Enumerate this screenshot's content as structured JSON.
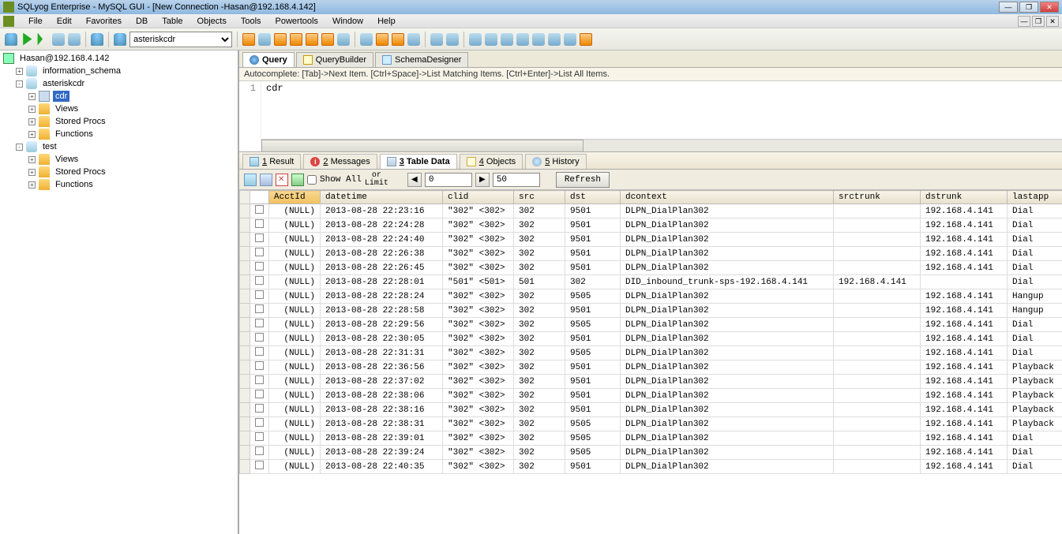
{
  "titlebar": {
    "title": "SQLyog Enterprise - MySQL GUI - [New Connection -Hasan@192.168.4.142]"
  },
  "menubar": {
    "items": [
      "File",
      "Edit",
      "Favorites",
      "DB",
      "Table",
      "Objects",
      "Tools",
      "Powertools",
      "Window",
      "Help"
    ]
  },
  "toolbar": {
    "db_select": "asteriskcdr"
  },
  "sidebar": {
    "root": "Hasan@192.168.4.142",
    "nodes": [
      {
        "level": 1,
        "exp": "+",
        "icon": "db",
        "label": "information_schema"
      },
      {
        "level": 1,
        "exp": "-",
        "icon": "db",
        "label": "asteriskcdr"
      },
      {
        "level": 2,
        "exp": "+",
        "icon": "table",
        "label": "cdr",
        "selected": true
      },
      {
        "level": 2,
        "exp": "+",
        "icon": "folder",
        "label": "Views"
      },
      {
        "level": 2,
        "exp": "+",
        "icon": "folder",
        "label": "Stored Procs"
      },
      {
        "level": 2,
        "exp": "+",
        "icon": "folder",
        "label": "Functions"
      },
      {
        "level": 1,
        "exp": "-",
        "icon": "db",
        "label": "test"
      },
      {
        "level": 2,
        "exp": "+",
        "icon": "folder",
        "label": "Views"
      },
      {
        "level": 2,
        "exp": "+",
        "icon": "folder",
        "label": "Stored Procs"
      },
      {
        "level": 2,
        "exp": "+",
        "icon": "folder",
        "label": "Functions"
      }
    ]
  },
  "subtabs": {
    "query": "Query",
    "querybuilder": "QueryBuilder",
    "schemadesigner": "SchemaDesigner"
  },
  "autocomplete_hint": "Autocomplete: [Tab]->Next Item. [Ctrl+Space]->List Matching Items. [Ctrl+Enter]->List All Items.",
  "editor": {
    "line_no": "1",
    "text": "cdr"
  },
  "result_tabs": {
    "result": "Result",
    "messages": "Messages",
    "tabledata": "Table Data",
    "objects": "Objects",
    "history": "History",
    "n1": "1",
    "n2": "2",
    "n3": "3",
    "n4": "4",
    "n5": "5"
  },
  "data_toolbar": {
    "show_all": "Show All",
    "or": "or",
    "limit": "Limit",
    "offset_val": "0",
    "limit_val": "50",
    "refresh": "Refresh"
  },
  "grid": {
    "columns": [
      "AcctId",
      "datetime",
      "clid",
      "src",
      "dst",
      "dcontext",
      "srctrunk",
      "dstrunk",
      "lastapp"
    ],
    "rows": [
      [
        "(NULL)",
        "2013-08-28 22:23:16",
        "\"302\" <302>",
        "302",
        "9501",
        "DLPN_DialPlan302",
        "",
        "192.168.4.141",
        "Dial"
      ],
      [
        "(NULL)",
        "2013-08-28 22:24:28",
        "\"302\" <302>",
        "302",
        "9501",
        "DLPN_DialPlan302",
        "",
        "192.168.4.141",
        "Dial"
      ],
      [
        "(NULL)",
        "2013-08-28 22:24:40",
        "\"302\" <302>",
        "302",
        "9501",
        "DLPN_DialPlan302",
        "",
        "192.168.4.141",
        "Dial"
      ],
      [
        "(NULL)",
        "2013-08-28 22:26:38",
        "\"302\" <302>",
        "302",
        "9501",
        "DLPN_DialPlan302",
        "",
        "192.168.4.141",
        "Dial"
      ],
      [
        "(NULL)",
        "2013-08-28 22:26:45",
        "\"302\" <302>",
        "302",
        "9501",
        "DLPN_DialPlan302",
        "",
        "192.168.4.141",
        "Dial"
      ],
      [
        "(NULL)",
        "2013-08-28 22:28:01",
        "\"501\" <501>",
        "501",
        "302",
        "DID_inbound_trunk-sps-192.168.4.141",
        "192.168.4.141",
        "",
        "Dial"
      ],
      [
        "(NULL)",
        "2013-08-28 22:28:24",
        "\"302\" <302>",
        "302",
        "9505",
        "DLPN_DialPlan302",
        "",
        "192.168.4.141",
        "Hangup"
      ],
      [
        "(NULL)",
        "2013-08-28 22:28:58",
        "\"302\" <302>",
        "302",
        "9501",
        "DLPN_DialPlan302",
        "",
        "192.168.4.141",
        "Hangup"
      ],
      [
        "(NULL)",
        "2013-08-28 22:29:56",
        "\"302\" <302>",
        "302",
        "9505",
        "DLPN_DialPlan302",
        "",
        "192.168.4.141",
        "Dial"
      ],
      [
        "(NULL)",
        "2013-08-28 22:30:05",
        "\"302\" <302>",
        "302",
        "9501",
        "DLPN_DialPlan302",
        "",
        "192.168.4.141",
        "Dial"
      ],
      [
        "(NULL)",
        "2013-08-28 22:31:31",
        "\"302\" <302>",
        "302",
        "9505",
        "DLPN_DialPlan302",
        "",
        "192.168.4.141",
        "Dial"
      ],
      [
        "(NULL)",
        "2013-08-28 22:36:56",
        "\"302\" <302>",
        "302",
        "9501",
        "DLPN_DialPlan302",
        "",
        "192.168.4.141",
        "Playback"
      ],
      [
        "(NULL)",
        "2013-08-28 22:37:02",
        "\"302\" <302>",
        "302",
        "9501",
        "DLPN_DialPlan302",
        "",
        "192.168.4.141",
        "Playback"
      ],
      [
        "(NULL)",
        "2013-08-28 22:38:06",
        "\"302\" <302>",
        "302",
        "9501",
        "DLPN_DialPlan302",
        "",
        "192.168.4.141",
        "Playback"
      ],
      [
        "(NULL)",
        "2013-08-28 22:38:16",
        "\"302\" <302>",
        "302",
        "9501",
        "DLPN_DialPlan302",
        "",
        "192.168.4.141",
        "Playback"
      ],
      [
        "(NULL)",
        "2013-08-28 22:38:31",
        "\"302\" <302>",
        "302",
        "9505",
        "DLPN_DialPlan302",
        "",
        "192.168.4.141",
        "Playback"
      ],
      [
        "(NULL)",
        "2013-08-28 22:39:01",
        "\"302\" <302>",
        "302",
        "9505",
        "DLPN_DialPlan302",
        "",
        "192.168.4.141",
        "Dial"
      ],
      [
        "(NULL)",
        "2013-08-28 22:39:24",
        "\"302\" <302>",
        "302",
        "9505",
        "DLPN_DialPlan302",
        "",
        "192.168.4.141",
        "Dial"
      ],
      [
        "(NULL)",
        "2013-08-28 22:40:35",
        "\"302\" <302>",
        "302",
        "9501",
        "DLPN_DialPlan302",
        "",
        "192.168.4.141",
        "Dial"
      ]
    ]
  }
}
